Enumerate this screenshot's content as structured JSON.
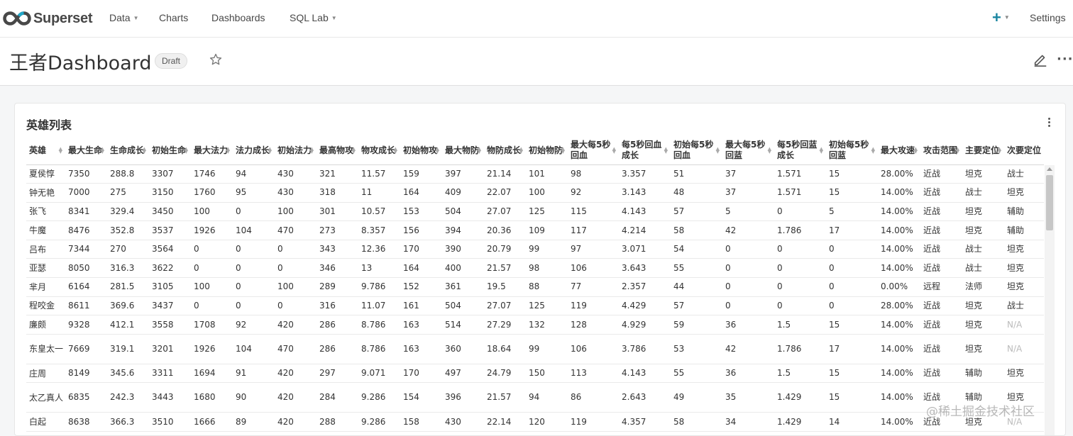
{
  "nav": {
    "logo_text": "Superset",
    "items": [
      {
        "label": "Data",
        "dropdown": true
      },
      {
        "label": "Charts",
        "dropdown": false
      },
      {
        "label": "Dashboards",
        "dropdown": false
      },
      {
        "label": "SQL Lab",
        "dropdown": true
      }
    ],
    "plus_label": "+",
    "settings_label": "Settings",
    "accent_color": "#1a85a0"
  },
  "dashboard": {
    "title": "王者Dashboard",
    "status_badge": "Draft",
    "icons": [
      "star-icon",
      "edit-icon",
      "more-icon"
    ]
  },
  "chart": {
    "title": "英雄列表",
    "columns": [
      "英雄",
      "最大生命",
      "生命成长",
      "初始生命",
      "最大法力",
      "法力成长",
      "初始法力",
      "最高物攻",
      "物攻成长",
      "初始物攻",
      "最大物防",
      "物防成长",
      "初始物防",
      "最大每5秒回血",
      "每5秒回血成长",
      "初始每5秒回血",
      "最大每5秒回蓝",
      "每5秒回蓝成长",
      "初始每5秒回蓝",
      "最大攻速",
      "攻击范围",
      "主要定位",
      "次要定位"
    ],
    "rows": [
      [
        "夏侯惇",
        "7350",
        "288.8",
        "3307",
        "1746",
        "94",
        "430",
        "321",
        "11.57",
        "159",
        "397",
        "21.14",
        "101",
        "98",
        "3.357",
        "51",
        "37",
        "1.571",
        "15",
        "28.00%",
        "近战",
        "坦克",
        "战士"
      ],
      [
        "钟无艳",
        "7000",
        "275",
        "3150",
        "1760",
        "95",
        "430",
        "318",
        "11",
        "164",
        "409",
        "22.07",
        "100",
        "92",
        "3.143",
        "48",
        "37",
        "1.571",
        "15",
        "14.00%",
        "近战",
        "战士",
        "坦克"
      ],
      [
        "张飞",
        "8341",
        "329.4",
        "3450",
        "100",
        "0",
        "100",
        "301",
        "10.57",
        "153",
        "504",
        "27.07",
        "125",
        "115",
        "4.143",
        "57",
        "5",
        "0",
        "5",
        "14.00%",
        "近战",
        "坦克",
        "辅助"
      ],
      [
        "牛魔",
        "8476",
        "352.8",
        "3537",
        "1926",
        "104",
        "470",
        "273",
        "8.357",
        "156",
        "394",
        "20.36",
        "109",
        "117",
        "4.214",
        "58",
        "42",
        "1.786",
        "17",
        "14.00%",
        "近战",
        "坦克",
        "辅助"
      ],
      [
        "吕布",
        "7344",
        "270",
        "3564",
        "0",
        "0",
        "0",
        "343",
        "12.36",
        "170",
        "390",
        "20.79",
        "99",
        "97",
        "3.071",
        "54",
        "0",
        "0",
        "0",
        "14.00%",
        "近战",
        "战士",
        "坦克"
      ],
      [
        "亚瑟",
        "8050",
        "316.3",
        "3622",
        "0",
        "0",
        "0",
        "346",
        "13",
        "164",
        "400",
        "21.57",
        "98",
        "106",
        "3.643",
        "55",
        "0",
        "0",
        "0",
        "14.00%",
        "近战",
        "战士",
        "坦克"
      ],
      [
        "芈月",
        "6164",
        "281.5",
        "3105",
        "100",
        "0",
        "100",
        "289",
        "9.786",
        "152",
        "361",
        "19.5",
        "88",
        "77",
        "2.357",
        "44",
        "0",
        "0",
        "0",
        "0.00%",
        "远程",
        "法师",
        "坦克"
      ],
      [
        "程咬金",
        "8611",
        "369.6",
        "3437",
        "0",
        "0",
        "0",
        "316",
        "11.07",
        "161",
        "504",
        "27.07",
        "125",
        "119",
        "4.429",
        "57",
        "0",
        "0",
        "0",
        "28.00%",
        "近战",
        "坦克",
        "战士"
      ],
      [
        "廉颇",
        "9328",
        "412.1",
        "3558",
        "1708",
        "92",
        "420",
        "286",
        "8.786",
        "163",
        "514",
        "27.29",
        "132",
        "128",
        "4.929",
        "59",
        "36",
        "1.5",
        "15",
        "14.00%",
        "近战",
        "坦克",
        "N/A"
      ],
      [
        "东皇太一",
        "7669",
        "319.1",
        "3201",
        "1926",
        "104",
        "470",
        "286",
        "8.786",
        "163",
        "360",
        "18.64",
        "99",
        "106",
        "3.786",
        "53",
        "42",
        "1.786",
        "17",
        "14.00%",
        "近战",
        "坦克",
        "N/A"
      ],
      [
        "庄周",
        "8149",
        "345.6",
        "3311",
        "1694",
        "91",
        "420",
        "297",
        "9.071",
        "170",
        "497",
        "24.79",
        "150",
        "113",
        "4.143",
        "55",
        "36",
        "1.5",
        "15",
        "14.00%",
        "近战",
        "辅助",
        "坦克"
      ],
      [
        "太乙真人",
        "6835",
        "242.3",
        "3443",
        "1680",
        "90",
        "420",
        "284",
        "9.286",
        "154",
        "396",
        "21.57",
        "94",
        "86",
        "2.643",
        "49",
        "35",
        "1.429",
        "15",
        "14.00%",
        "近战",
        "辅助",
        "坦克"
      ],
      [
        "白起",
        "8638",
        "366.3",
        "3510",
        "1666",
        "89",
        "420",
        "288",
        "9.286",
        "158",
        "430",
        "22.14",
        "120",
        "119",
        "4.357",
        "58",
        "34",
        "1.429",
        "14",
        "14.00%",
        "近战",
        "坦克",
        "N/A"
      ]
    ]
  },
  "watermark": "@稀土掘金技术社区"
}
